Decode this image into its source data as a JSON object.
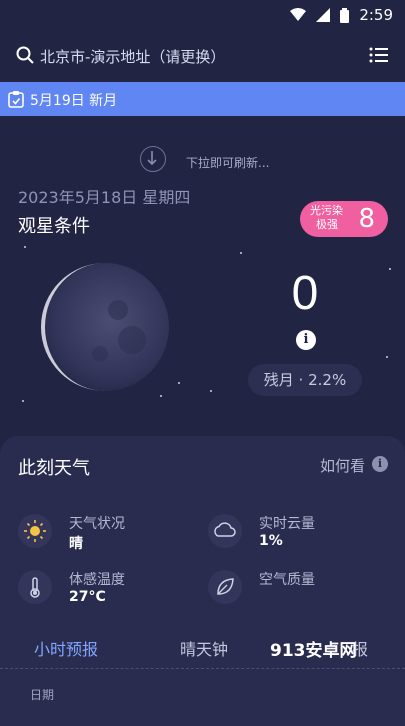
{
  "status_bar": {
    "time": "2:59"
  },
  "search": {
    "location_text": "北京市-演示地址（请更换）"
  },
  "banner": {
    "text": "5月19日 新月"
  },
  "pull_refresh": {
    "text": "下拉即可刷新..."
  },
  "stargazing": {
    "date": "2023年5月18日 星期四",
    "title": "观星条件",
    "light_pollution_line1": "光污染",
    "light_pollution_line2": "极强",
    "light_pollution_value": "8",
    "score": "0",
    "moon_phase": "残月 · 2.2%"
  },
  "weather_now": {
    "title": "此刻天气",
    "how_to_read": "如何看",
    "items": [
      {
        "icon": "sun-icon",
        "label": "天气状况",
        "value": "晴"
      },
      {
        "icon": "cloud-icon",
        "label": "实时云量",
        "value": "1%"
      },
      {
        "icon": "thermometer-icon",
        "label": "体感温度",
        "value": "27°C"
      },
      {
        "icon": "leaf-icon",
        "label": "空气质量",
        "value": ""
      }
    ]
  },
  "tabs": [
    "小时预报",
    "晴天钟",
    "报"
  ],
  "watermark": "913安卓网",
  "table": {
    "date_header": "日期"
  },
  "colors": {
    "accent": "#5f86f2",
    "badge": "#f05fa0",
    "background": "#222444"
  }
}
